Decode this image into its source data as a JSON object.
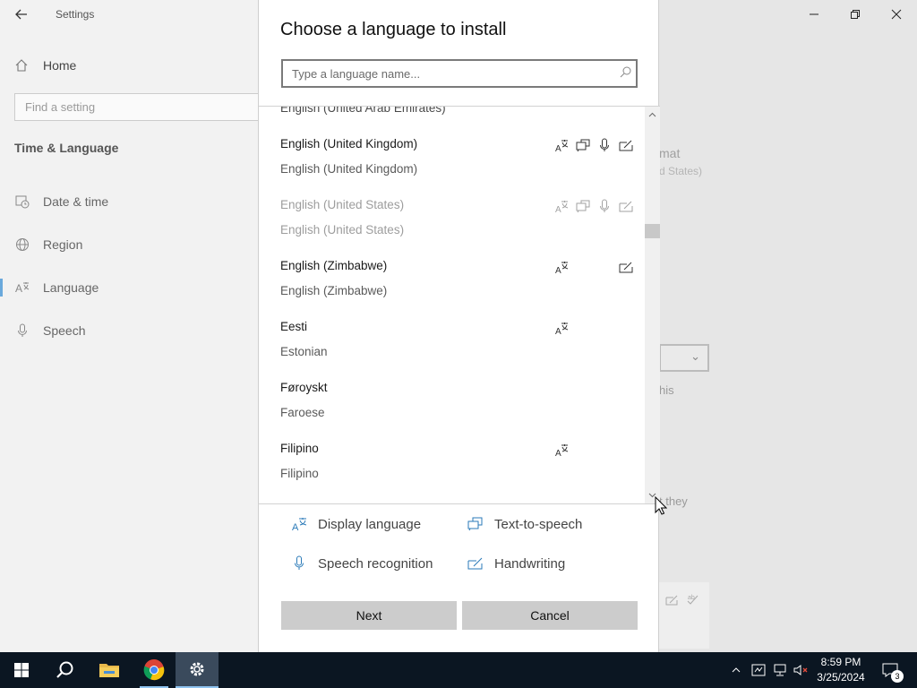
{
  "settings": {
    "app_title": "Settings",
    "nav_home": "Home",
    "search_placeholder": "Find a setting",
    "section_title": "Time & Language",
    "nav_items": [
      {
        "label": "Date & time",
        "icon": "calendar-clock-icon"
      },
      {
        "label": "Region",
        "icon": "globe-icon"
      },
      {
        "label": "Language",
        "icon": "language-icon"
      },
      {
        "label": "Speech",
        "icon": "microphone-icon"
      }
    ],
    "active_nav": "Language",
    "bg_fragments": {
      "format": "mat",
      "format_value": "d States)",
      "this": "his",
      "they": "t they"
    }
  },
  "dialog": {
    "title": "Choose a language to install",
    "search_placeholder": "Type a language name...",
    "partial_item": "English (United Arab Emirates)",
    "languages": [
      {
        "name": "English (United Kingdom)",
        "native": "English (United Kingdom)",
        "features": [
          "display",
          "tts",
          "speech",
          "handwriting"
        ],
        "disabled": false
      },
      {
        "name": "English (United States)",
        "native": "English (United States)",
        "features": [
          "display",
          "tts",
          "speech",
          "handwriting"
        ],
        "disabled": true
      },
      {
        "name": "English (Zimbabwe)",
        "native": "English (Zimbabwe)",
        "features": [
          "display",
          "handwriting"
        ],
        "disabled": false
      },
      {
        "name": "Eesti",
        "native": "Estonian",
        "features": [
          "display"
        ],
        "disabled": false
      },
      {
        "name": "Føroyskt",
        "native": "Faroese",
        "features": [],
        "disabled": false
      },
      {
        "name": "Filipino",
        "native": "Filipino",
        "features": [
          "display"
        ],
        "disabled": false
      }
    ],
    "legend": {
      "display": "Display language",
      "tts": "Text-to-speech",
      "speech": "Speech recognition",
      "handwriting": "Handwriting"
    },
    "next_label": "Next",
    "cancel_label": "Cancel"
  },
  "taskbar": {
    "time": "8:59 PM",
    "date": "3/25/2024",
    "notification_count": "3",
    "pinned": [
      "start-icon",
      "search-icon",
      "chrome-icon",
      "file-explorer-icon",
      "settings-icon"
    ]
  },
  "colors": {
    "accent": "#0078d7",
    "taskbar": "#0b1622",
    "button": "#cccccc"
  }
}
